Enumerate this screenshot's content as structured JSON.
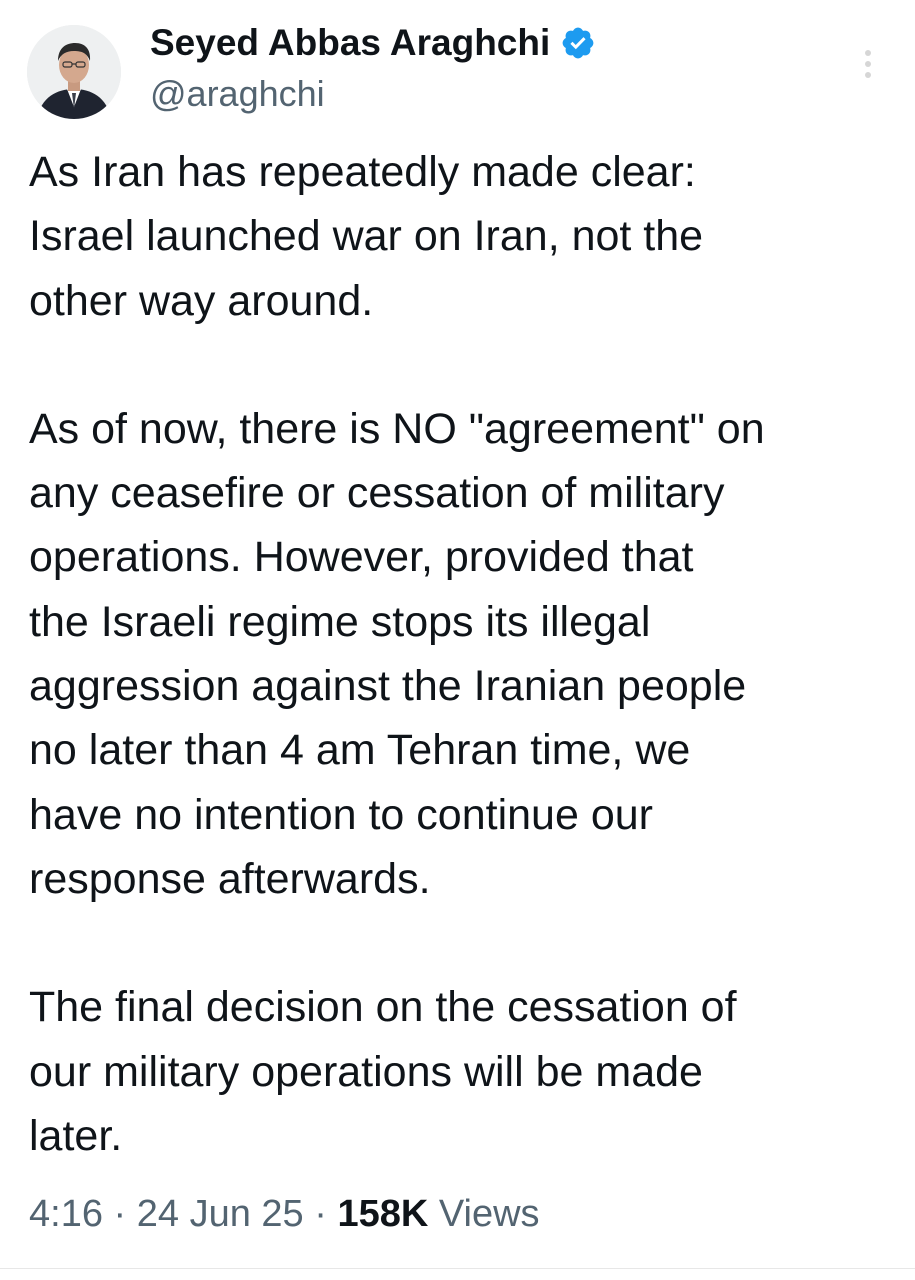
{
  "author": {
    "display_name": "Seyed Abbas Araghchi",
    "handle": "@araghchi",
    "verified_icon": "verified-badge-icon",
    "badge_color": "#1d9bf0"
  },
  "tweet": {
    "paragraphs": [
      "As Iran has repeatedly made clear:\nIsrael launched war on Iran, not the\nother way around.",
      "As of now, there is NO \"agreement\" on\nany ceasefire or cessation of military\noperations. However, provided that\nthe Israeli regime stops its illegal\naggression against the Iranian people\nno later than 4 am Tehran time, we\nhave no intention to continue our\nresponse afterwards.",
      "The final decision on the cessation of\nour military operations will be made\nlater."
    ]
  },
  "meta": {
    "time": "4:16",
    "date": "24 Jun 25",
    "views_count": "158K",
    "views_label": "Views",
    "separator": "·"
  }
}
